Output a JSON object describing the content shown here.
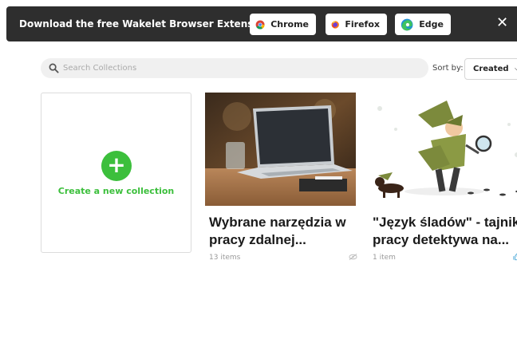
{
  "banner": {
    "text": "Download the free Wakelet Browser Extension",
    "chrome_label": "Chrome",
    "firefox_label": "Firefox",
    "edge_label": "Edge",
    "close_symbol": "✕"
  },
  "search": {
    "placeholder": "Search Collections"
  },
  "sort": {
    "label": "Sort by:",
    "value": "Created",
    "chevron": "⌵"
  },
  "new_collection": {
    "symbol": "+",
    "label": "Create a new collection"
  },
  "collections": [
    {
      "title_line1": "Wybrane narzędzia w",
      "title_line2": "pracy zdalnej...",
      "meta": "13 items",
      "icon": "eye-hidden-icon"
    },
    {
      "title_line1": "\"Język śladów\" - tajniki",
      "title_line2": "pracy detektywa na...",
      "meta": "1 item",
      "icon": "thumbs-up-icon"
    }
  ],
  "colors": {
    "banner_bg": "#2e2e2e",
    "accent_green": "#3cbf3c",
    "search_bg": "#f0f0f0"
  }
}
